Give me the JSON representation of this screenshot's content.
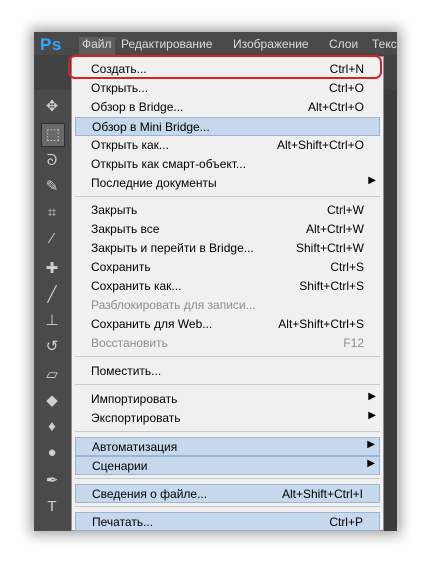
{
  "app": {
    "logo": "Ps"
  },
  "menubar": [
    "Файл",
    "Редактирование",
    "Изображение",
    "Слои",
    "Текст"
  ],
  "menubar_active": "Файл",
  "tools": [
    "move-tool-icon",
    "marquee-tool-icon",
    "lasso-tool-icon",
    "quick-select-tool-icon",
    "crop-tool-icon",
    "eyedropper-tool-icon",
    "spot-healing-tool-icon",
    "brush-tool-icon",
    "clone-stamp-tool-icon",
    "history-brush-tool-icon",
    "eraser-tool-icon",
    "paint-bucket-tool-icon",
    "blur-tool-icon",
    "dodge-tool-icon",
    "pen-tool-icon",
    "type-tool-icon"
  ],
  "file_menu": {
    "g1": [
      {
        "label": "Создать...",
        "shortcut": "Ctrl+N"
      },
      {
        "label": "Открыть...",
        "shortcut": "Ctrl+O"
      },
      {
        "label": "Обзор в Bridge...",
        "shortcut": "Alt+Ctrl+O"
      },
      {
        "label": "Обзор в Mini Bridge...",
        "shortcut": ""
      },
      {
        "label": "Открыть как...",
        "shortcut": "Alt+Shift+Ctrl+O"
      },
      {
        "label": "Открыть как смарт-объект...",
        "shortcut": ""
      },
      {
        "label": "Последние документы",
        "shortcut": ""
      }
    ],
    "g2": [
      {
        "label": "Закрыть",
        "shortcut": "Ctrl+W"
      },
      {
        "label": "Закрыть все",
        "shortcut": "Alt+Ctrl+W"
      },
      {
        "label": "Закрыть и перейти в Bridge...",
        "shortcut": "Shift+Ctrl+W"
      },
      {
        "label": "Сохранить",
        "shortcut": "Ctrl+S"
      },
      {
        "label": "Сохранить как...",
        "shortcut": "Shift+Ctrl+S"
      },
      {
        "label": "Разблокировать для записи...",
        "shortcut": ""
      },
      {
        "label": "Сохранить для Web...",
        "shortcut": "Alt+Shift+Ctrl+S"
      },
      {
        "label": "Восстановить",
        "shortcut": "F12"
      }
    ],
    "g3": [
      {
        "label": "Поместить...",
        "shortcut": ""
      }
    ],
    "g4": [
      {
        "label": "Импортировать",
        "shortcut": ""
      },
      {
        "label": "Экспортировать",
        "shortcut": ""
      }
    ],
    "g5": [
      {
        "label": "Автоматизация",
        "shortcut": ""
      },
      {
        "label": "Сценарии",
        "shortcut": ""
      }
    ],
    "g6": [
      {
        "label": "Сведения о файле...",
        "shortcut": "Alt+Shift+Ctrl+I"
      }
    ],
    "g7": [
      {
        "label": "Печатать...",
        "shortcut": "Ctrl+P"
      }
    ]
  }
}
